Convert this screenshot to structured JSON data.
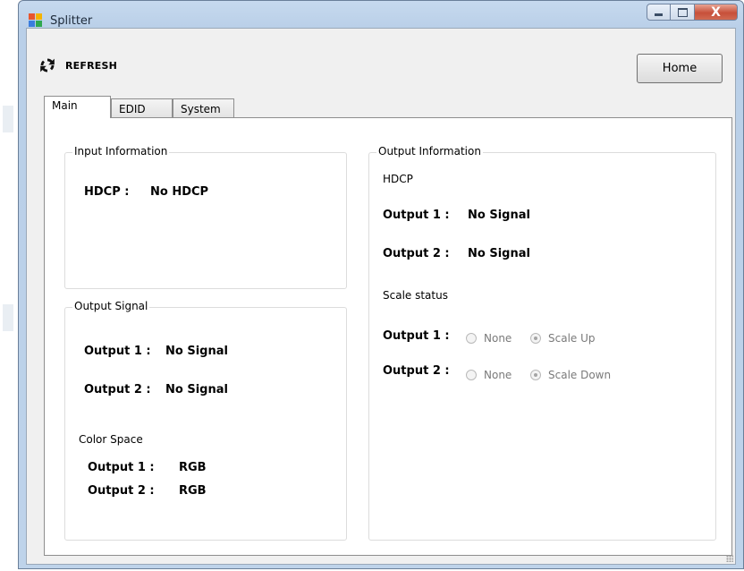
{
  "window": {
    "title": "Splitter",
    "icon": "splitter-app-icon",
    "controls": {
      "minimize": "minimize-icon",
      "maximize": "maximize-icon",
      "close": "X"
    }
  },
  "toolbar": {
    "refresh_label": "REFRESH",
    "refresh_icon": "refresh-icon",
    "home_label": "Home"
  },
  "tabs": [
    {
      "label": "Main",
      "active": true
    },
    {
      "label": "EDID",
      "active": false
    },
    {
      "label": "System",
      "active": false
    }
  ],
  "input_info": {
    "title": "Input Information",
    "hdcp_label": "HDCP :",
    "hdcp_value": "No HDCP"
  },
  "output_signal": {
    "title": "Output Signal",
    "rows": [
      {
        "label": "Output 1 :",
        "value": "No Signal"
      },
      {
        "label": "Output 2 :",
        "value": "No Signal"
      }
    ],
    "color_space_title": "Color Space",
    "color_rows": [
      {
        "label": "Output 1 :",
        "value": "RGB"
      },
      {
        "label": "Output 2 :",
        "value": "RGB"
      }
    ]
  },
  "output_info": {
    "title": "Output Information",
    "hdcp_title": "HDCP",
    "hdcp_rows": [
      {
        "label": "Output 1 :",
        "value": "No Signal"
      },
      {
        "label": "Output 2 :",
        "value": "No Signal"
      }
    ],
    "scale_title": "Scale status",
    "scale_rows": [
      {
        "label": "Output 1 :",
        "opt_none": "None",
        "opt_scale": "Scale Up",
        "selected": "Scale Up"
      },
      {
        "label": "Output 2 :",
        "opt_none": "None",
        "opt_scale": "Scale Down",
        "selected": "Scale Down"
      }
    ]
  }
}
